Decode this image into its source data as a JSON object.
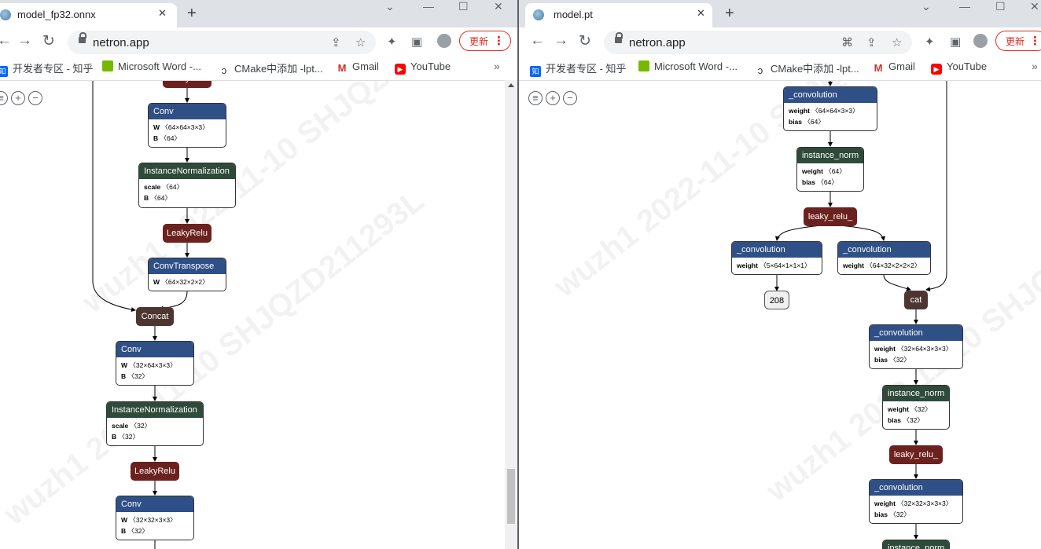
{
  "left": {
    "tab_title": "model_fp32.onnx",
    "url": "netron.app",
    "update_label": "更新",
    "bookmarks": [
      "开发者专区 - 知乎",
      "Microsoft Word -...",
      "CMake中添加 -lpt...",
      "Gmail",
      "YouTube"
    ],
    "nodes": {
      "top_partial": "LeakyRelu",
      "conv1": {
        "title": "Conv",
        "rows": [
          [
            "W",
            "〈64×64×3×3〉"
          ],
          [
            "B",
            "〈64〉"
          ]
        ]
      },
      "inorm1": {
        "title": "InstanceNormalization",
        "rows": [
          [
            "scale",
            "〈64〉"
          ],
          [
            "B",
            "〈64〉"
          ]
        ]
      },
      "relu1": "LeakyRelu",
      "convt": {
        "title": "ConvTranspose",
        "rows": [
          [
            "W",
            "〈64×32×2×2〉"
          ]
        ]
      },
      "concat": "Concat",
      "conv2": {
        "title": "Conv",
        "rows": [
          [
            "W",
            "〈32×64×3×3〉"
          ],
          [
            "B",
            "〈32〉"
          ]
        ]
      },
      "inorm2": {
        "title": "InstanceNormalization",
        "rows": [
          [
            "scale",
            "〈32〉"
          ],
          [
            "B",
            "〈32〉"
          ]
        ]
      },
      "relu2": "LeakyRelu",
      "conv3": {
        "title": "Conv",
        "rows": [
          [
            "W",
            "〈32×32×3×3〉"
          ],
          [
            "B",
            "〈32〉"
          ]
        ]
      }
    }
  },
  "right": {
    "tab_title": "model.pt",
    "url": "netron.app",
    "update_label": "更新",
    "bookmarks": [
      "开发者专区 - 知乎",
      "Microsoft Word -...",
      "CMake中添加 -lpt...",
      "Gmail",
      "YouTube"
    ],
    "nodes": {
      "conv1": {
        "title": "_convolution",
        "rows": [
          [
            "weight",
            "〈64×64×3×3〉"
          ],
          [
            "bias",
            "〈64〉"
          ]
        ]
      },
      "inorm1": {
        "title": "instance_norm",
        "rows": [
          [
            "weight",
            "〈64〉"
          ],
          [
            "bias",
            "〈64〉"
          ]
        ]
      },
      "relu1": "leaky_relu_",
      "conv_out": {
        "title": "_convolution",
        "rows": [
          [
            "weight",
            "〈5×64×1×1×1〉"
          ]
        ]
      },
      "out_label": "208",
      "convt": {
        "title": "_convolution",
        "rows": [
          [
            "weight",
            "〈64×32×2×2×2〉"
          ]
        ]
      },
      "cat": "cat",
      "conv2": {
        "title": "_convolution",
        "rows": [
          [
            "weight",
            "〈32×64×3×3×3〉"
          ],
          [
            "bias",
            "〈32〉"
          ]
        ]
      },
      "inorm2": {
        "title": "instance_norm",
        "rows": [
          [
            "weight",
            "〈32〉"
          ],
          [
            "bias",
            "〈32〉"
          ]
        ]
      },
      "relu2": "leaky_relu_",
      "conv3": {
        "title": "_convolution",
        "rows": [
          [
            "weight",
            "〈32×32×3×3×3〉"
          ],
          [
            "bias",
            "〈32〉"
          ]
        ]
      },
      "bottom_partial": "instance_norm"
    }
  },
  "watermark": "wuzh1  2022-11-10  SHJQZD211293L",
  "colors": {
    "conv": "#2f4f87",
    "norm": "#2e4a3a",
    "activation": "#6b211d",
    "concat": "#4d3632",
    "update": "#d93025"
  }
}
